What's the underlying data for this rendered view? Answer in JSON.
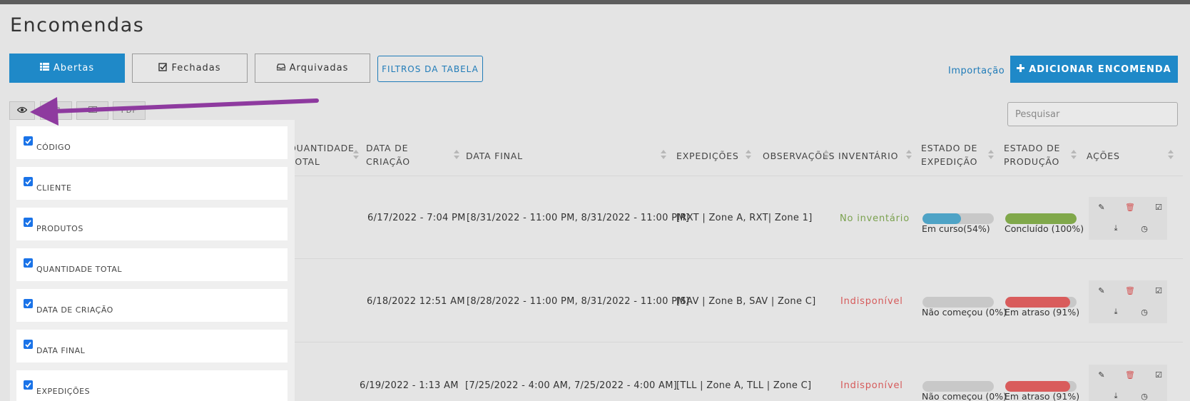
{
  "page": {
    "title": "Encomendas"
  },
  "tabs": [
    {
      "label": "Abertas",
      "icon": "list-icon",
      "active": true
    },
    {
      "label": "Fechadas",
      "icon": "check-square-icon",
      "active": false
    },
    {
      "label": "Arquivadas",
      "icon": "inbox-icon",
      "active": false
    }
  ],
  "filters_button": "FILTROS DA TABELA",
  "import_link": "Importação",
  "add_button": "ADICIONAR ENCOMENDA",
  "export_buttons": {
    "pdf": "PDF"
  },
  "search": {
    "placeholder": "Pesquisar",
    "value": ""
  },
  "headers": {
    "quantidade_l1": "QUANTIDADE",
    "quantidade_l2": "TOTAL",
    "data_criacao_l1": "DATA DE",
    "data_criacao_l2": "CRIAÇÃO",
    "data_final": "DATA FINAL",
    "expedicoes": "EXPEDIÇÕES",
    "observacoes": "OBSERVAÇÕES",
    "inventario": "INVENTÁRIO",
    "estado_exp_l1": "ESTADO DE",
    "estado_exp_l2": "EXPEDIÇÃO",
    "estado_prod_l1": "ESTADO DE",
    "estado_prod_l2": "PRODUÇÃO",
    "acoes": "AÇÕES"
  },
  "rows": [
    {
      "data_criacao": "6/17/2022 - 7:04 PM",
      "data_final": "[8/31/2022 - 11:00 PM, 8/31/2022 - 11:00 PM]",
      "expedicoes": "[RXT | Zone A, RXT| Zone 1]",
      "inventario": "No inventário",
      "inventario_status": "ok",
      "exp_label": "Em curso(54%)",
      "exp_percent": 54,
      "exp_color": "#4ea3c6",
      "prod_label": "Concluído (100%)",
      "prod_percent": 100,
      "prod_color": "#80a84a"
    },
    {
      "data_criacao": "6/18/2022 12:51 AM",
      "data_final": "[8/28/2022 - 11:00 PM, 8/31/2022 - 11:00 PM]",
      "expedicoes": "[SAV | Zone B, SAV | Zone C]",
      "inventario": "Indisponível",
      "inventario_status": "no",
      "exp_label": "Não começou (0%)",
      "exp_percent": 0,
      "exp_color": "#c8c8c8",
      "prod_label": "Em atraso (91%)",
      "prod_percent": 91,
      "prod_color": "#d95c5c"
    },
    {
      "data_criacao": "6/19/2022 - 1:13 AM",
      "data_final": "[7/25/2022 - 4:00 AM, 7/25/2022 - 4:00  AM]",
      "expedicoes": "[TLL | Zone A, TLL | Zone C]",
      "inventario": "Indisponível",
      "inventario_status": "no",
      "exp_label": "Não começou (0%)",
      "exp_percent": 0,
      "exp_color": "#c8c8c8",
      "prod_label": "Em atraso (91%)",
      "prod_percent": 91,
      "prod_color": "#d95c5c"
    }
  ],
  "column_toggle": {
    "items": [
      {
        "label": "CÓDIGO",
        "checked": true
      },
      {
        "label": "CLIENTE",
        "checked": true
      },
      {
        "label": "PRODUTOS",
        "checked": true
      },
      {
        "label": "QUANTIDADE TOTAL",
        "checked": true
      },
      {
        "label": "DATA DE CRIAÇÃO",
        "checked": true
      },
      {
        "label": "DATA FINAL",
        "checked": true
      },
      {
        "label": "EXPEDIÇÕES",
        "checked": true
      }
    ]
  },
  "colors": {
    "primary": "#1f89c8",
    "annotation_arrow": "#8e3a9f"
  }
}
